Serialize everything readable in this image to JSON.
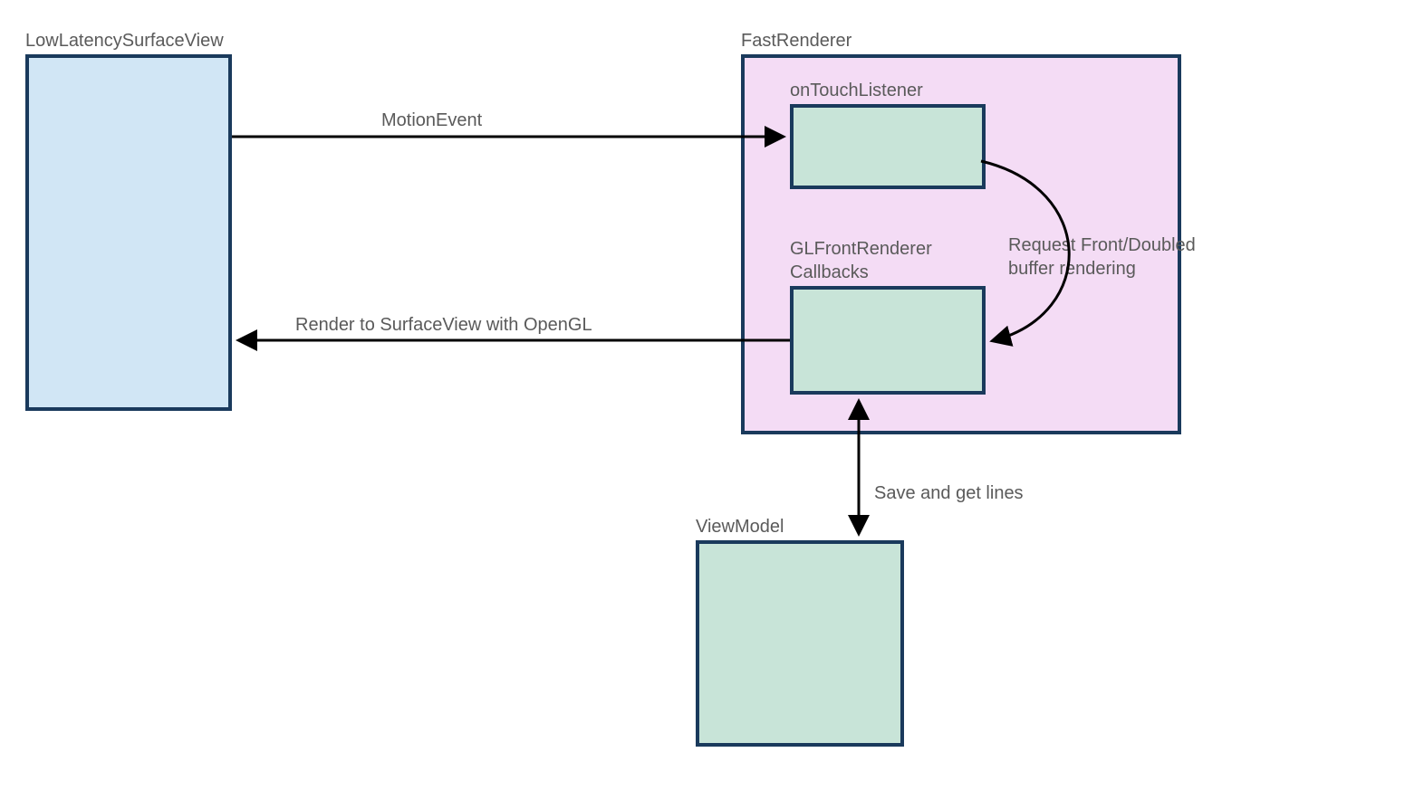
{
  "boxes": {
    "lowLatencySurfaceView": {
      "label": "LowLatencySurfaceView"
    },
    "fastRenderer": {
      "label": "FastRenderer"
    },
    "onTouchListener": {
      "label": "onTouchListener"
    },
    "glFrontRendererCallbacks": {
      "label": "GLFrontRenderer\nCallbacks"
    },
    "viewModel": {
      "label": "ViewModel"
    }
  },
  "edges": {
    "motionEvent": {
      "label": "MotionEvent"
    },
    "renderToSurfaceView": {
      "label": "Render to SurfaceView with OpenGL"
    },
    "requestFrontDoubled": {
      "label": "Request Front/Doubled\nbuffer rendering"
    },
    "saveAndGetLines": {
      "label": "Save and get lines"
    }
  },
  "colors": {
    "border": "#1a3a5c",
    "blueFill": "#d1e6f5",
    "greenFill": "#c8e4d8",
    "pinkFill": "#f4dcf5",
    "text": "#5a5a5a",
    "arrow": "#000000"
  }
}
